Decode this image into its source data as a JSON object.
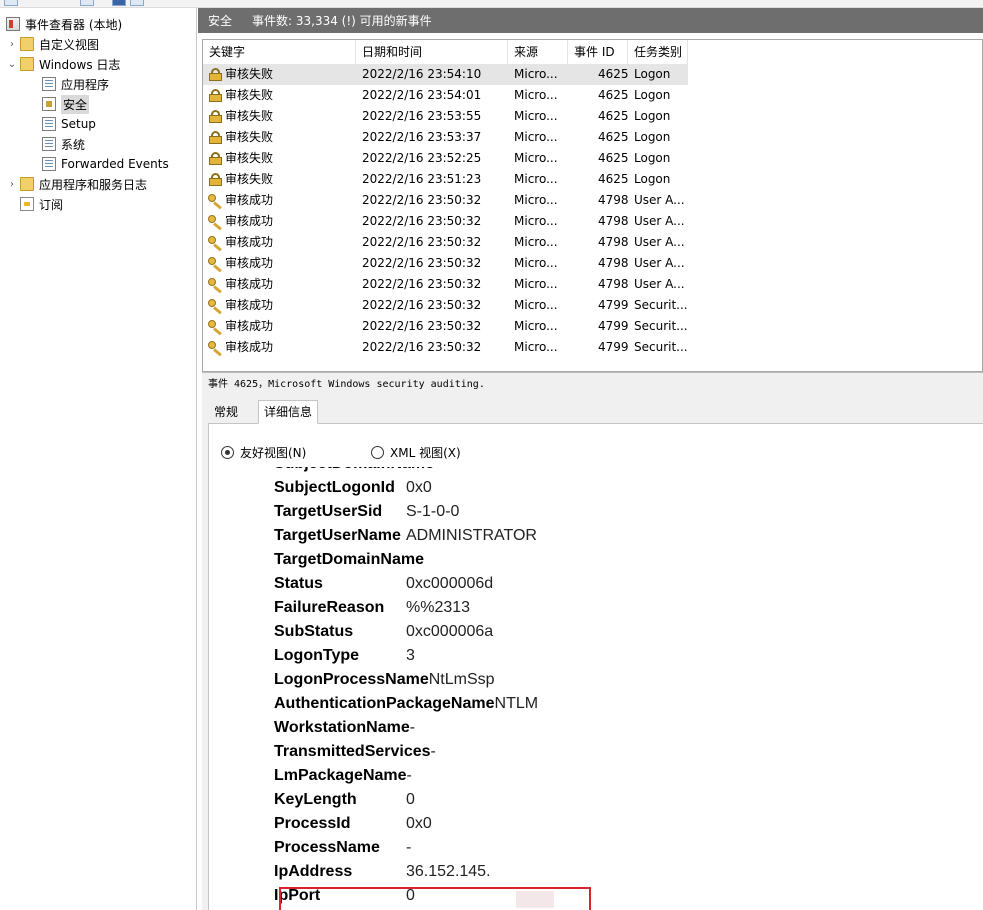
{
  "tree": {
    "items": [
      {
        "label": "事件查看器 (本地)",
        "icon": "event-viewer-icon",
        "arrow": "",
        "level": 0
      },
      {
        "label": "自定义视图",
        "icon": "folder-icon",
        "arrow": "›",
        "level": 1
      },
      {
        "label": "Windows 日志",
        "icon": "folder-icon",
        "arrow": "⌄",
        "level": 1
      },
      {
        "label": "应用程序",
        "icon": "log-icon",
        "arrow": "",
        "level": 2
      },
      {
        "label": "安全",
        "icon": "security-log-icon",
        "arrow": "",
        "level": 2,
        "selected": true
      },
      {
        "label": "Setup",
        "icon": "log-icon",
        "arrow": "",
        "level": 2
      },
      {
        "label": "系统",
        "icon": "log-icon",
        "arrow": "",
        "level": 2
      },
      {
        "label": "Forwarded Events",
        "icon": "log-icon",
        "arrow": "",
        "level": 2
      },
      {
        "label": "应用程序和服务日志",
        "icon": "folder-icon",
        "arrow": "›",
        "level": 1
      },
      {
        "label": "订阅",
        "icon": "subscription-icon",
        "arrow": "",
        "level": 1
      }
    ]
  },
  "header": {
    "title": "安全",
    "count": "事件数: 33,334 (!) 可用的新事件"
  },
  "list": {
    "columns": [
      "关键字",
      "日期和时间",
      "来源",
      "事件 ID",
      "任务类别"
    ],
    "rows": [
      {
        "keyword": "审核失败",
        "type": "fail",
        "datetime": "2022/2/16 23:54:10",
        "source": "Micro...",
        "id": "4625",
        "category": "Logon"
      },
      {
        "keyword": "审核失败",
        "type": "fail",
        "datetime": "2022/2/16 23:54:01",
        "source": "Micro...",
        "id": "4625",
        "category": "Logon"
      },
      {
        "keyword": "审核失败",
        "type": "fail",
        "datetime": "2022/2/16 23:53:55",
        "source": "Micro...",
        "id": "4625",
        "category": "Logon"
      },
      {
        "keyword": "审核失败",
        "type": "fail",
        "datetime": "2022/2/16 23:53:37",
        "source": "Micro...",
        "id": "4625",
        "category": "Logon"
      },
      {
        "keyword": "审核失败",
        "type": "fail",
        "datetime": "2022/2/16 23:52:25",
        "source": "Micro...",
        "id": "4625",
        "category": "Logon"
      },
      {
        "keyword": "审核失败",
        "type": "fail",
        "datetime": "2022/2/16 23:51:23",
        "source": "Micro...",
        "id": "4625",
        "category": "Logon"
      },
      {
        "keyword": "审核成功",
        "type": "success",
        "datetime": "2022/2/16 23:50:32",
        "source": "Micro...",
        "id": "4798",
        "category": "User A..."
      },
      {
        "keyword": "审核成功",
        "type": "success",
        "datetime": "2022/2/16 23:50:32",
        "source": "Micro...",
        "id": "4798",
        "category": "User A..."
      },
      {
        "keyword": "审核成功",
        "type": "success",
        "datetime": "2022/2/16 23:50:32",
        "source": "Micro...",
        "id": "4798",
        "category": "User A..."
      },
      {
        "keyword": "审核成功",
        "type": "success",
        "datetime": "2022/2/16 23:50:32",
        "source": "Micro...",
        "id": "4798",
        "category": "User A..."
      },
      {
        "keyword": "审核成功",
        "type": "success",
        "datetime": "2022/2/16 23:50:32",
        "source": "Micro...",
        "id": "4798",
        "category": "User A..."
      },
      {
        "keyword": "审核成功",
        "type": "success",
        "datetime": "2022/2/16 23:50:32",
        "source": "Micro...",
        "id": "4799",
        "category": "Securit..."
      },
      {
        "keyword": "审核成功",
        "type": "success",
        "datetime": "2022/2/16 23:50:32",
        "source": "Micro...",
        "id": "4799",
        "category": "Securit..."
      },
      {
        "keyword": "审核成功",
        "type": "success",
        "datetime": "2022/2/16 23:50:32",
        "source": "Micro...",
        "id": "4799",
        "category": "Securit..."
      }
    ]
  },
  "detail": {
    "title": "事件 4625，Microsoft Windows security auditing.",
    "tabs": [
      "常规",
      "详细信息"
    ],
    "active_tab": 1,
    "radio": {
      "friendly": "友好视图(N)",
      "xml": "XML 视图(X)",
      "selected": "friendly"
    },
    "fields": [
      {
        "key": "SubjectDomainName",
        "value": "-"
      },
      {
        "key": "SubjectLogonId",
        "value": "0x0"
      },
      {
        "key": "TargetUserSid",
        "value": "S-1-0-0"
      },
      {
        "key": "TargetUserName",
        "value": "ADMINISTRATOR"
      },
      {
        "key": "TargetDomainName",
        "value": ""
      },
      {
        "key": "Status",
        "value": "0xc000006d"
      },
      {
        "key": "FailureReason",
        "value": "%%2313"
      },
      {
        "key": "SubStatus",
        "value": "0xc000006a"
      },
      {
        "key": "LogonType",
        "value": "3"
      },
      {
        "key": "LogonProcessName",
        "value": "NtLmSsp"
      },
      {
        "key": "AuthenticationPackageName",
        "value": "NTLM"
      },
      {
        "key": "WorkstationName",
        "value": "-"
      },
      {
        "key": "TransmittedServices",
        "value": "-"
      },
      {
        "key": "LmPackageName",
        "value": "-"
      },
      {
        "key": "KeyLength",
        "value": "0"
      },
      {
        "key": "ProcessId",
        "value": "0x0"
      },
      {
        "key": "ProcessName",
        "value": "-"
      },
      {
        "key": "IpAddress",
        "value": "36.152.145."
      },
      {
        "key": "IpPort",
        "value": "0"
      }
    ]
  },
  "colors": {
    "header_bg": "#6e6e6e",
    "highlight": "#d9232e",
    "selected_row": "#e5e5e5"
  }
}
